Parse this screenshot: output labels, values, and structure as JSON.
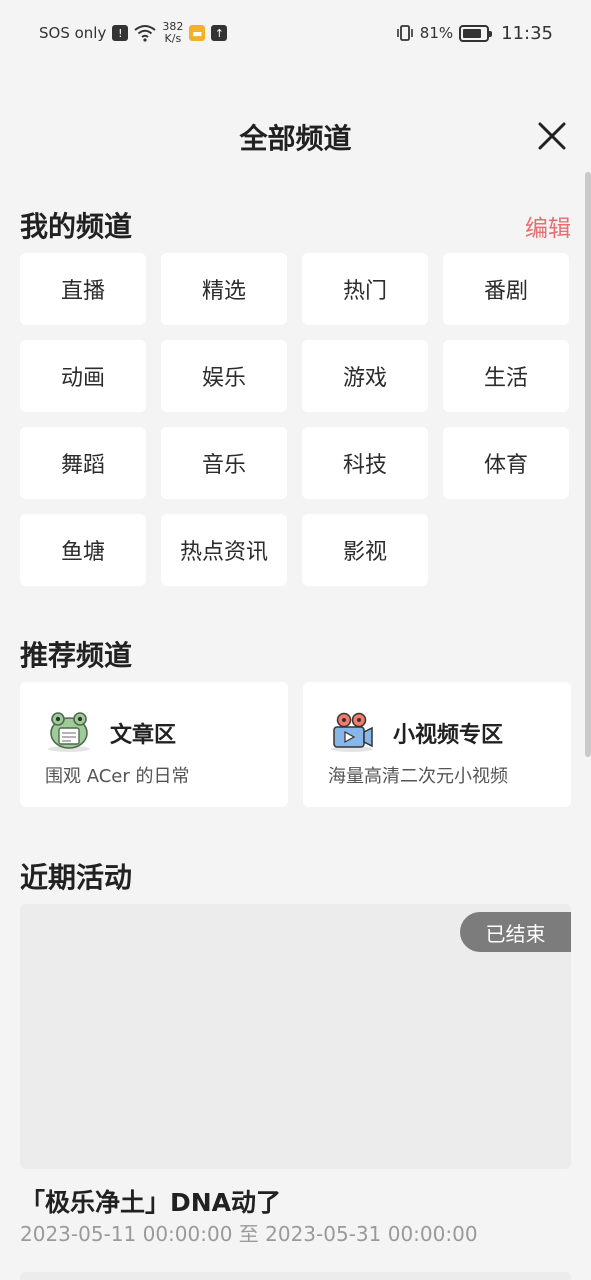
{
  "status_bar": {
    "carrier": "SOS only",
    "net_speed_value": "382",
    "net_speed_unit": "K/s",
    "battery": "81%",
    "time": "11:35"
  },
  "header": {
    "title": "全部频道"
  },
  "my_channels": {
    "title": "我的频道",
    "edit_label": "编辑",
    "items": [
      {
        "label": "直播"
      },
      {
        "label": "精选"
      },
      {
        "label": "热门"
      },
      {
        "label": "番剧"
      },
      {
        "label": "动画"
      },
      {
        "label": "娱乐"
      },
      {
        "label": "游戏"
      },
      {
        "label": "生活"
      },
      {
        "label": "舞蹈"
      },
      {
        "label": "音乐"
      },
      {
        "label": "科技"
      },
      {
        "label": "体育"
      },
      {
        "label": "鱼塘"
      },
      {
        "label": "热点资讯"
      },
      {
        "label": "影视"
      }
    ]
  },
  "recommended": {
    "title": "推荐频道",
    "items": [
      {
        "name": "文章区",
        "desc": "围观 ACer 的日常",
        "icon": "frog-mascot-icon"
      },
      {
        "name": "小视频专区",
        "desc": "海量高清二次元小视频",
        "icon": "video-camera-icon"
      }
    ]
  },
  "activities": {
    "title": "近期活动",
    "items": [
      {
        "badge": "已结束",
        "title": "「极乐净土」DNA动了",
        "dates": "2023-05-11 00:00:00 至 2023-05-31 00:00:00"
      }
    ]
  },
  "colors": {
    "accent": "#e36f72",
    "background": "#f4f4f4",
    "card": "#ffffff",
    "badge": "#7c7c7c"
  }
}
